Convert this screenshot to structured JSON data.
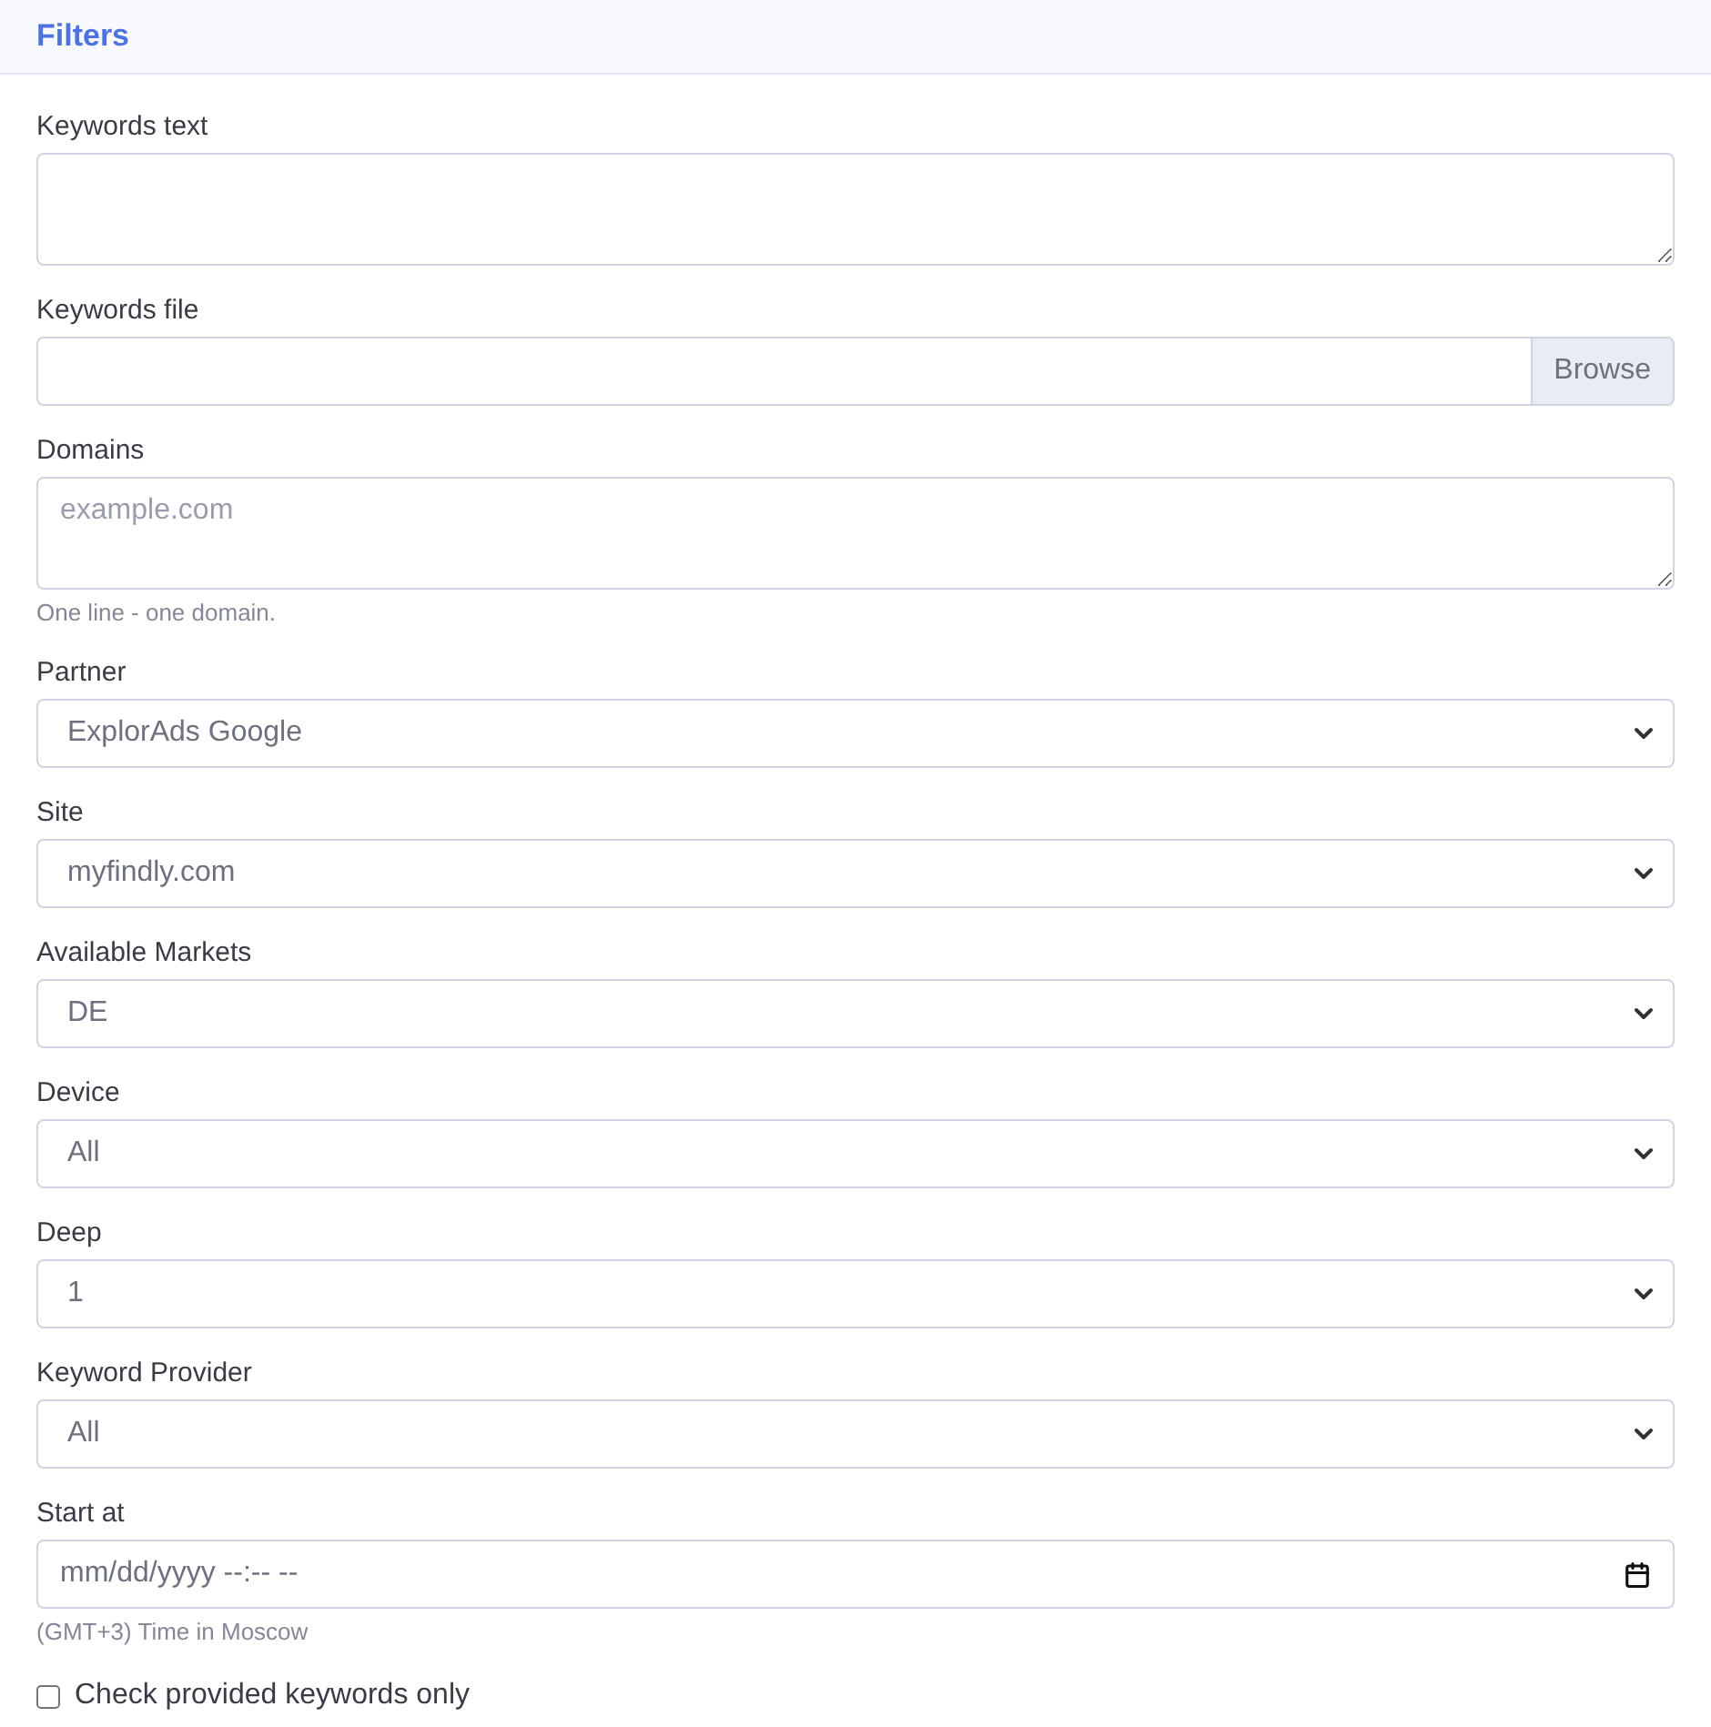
{
  "header": {
    "title": "Filters"
  },
  "fields": [
    {
      "kind": "textarea",
      "label": "Keywords text"
    },
    {
      "kind": "file",
      "label": "Keywords file",
      "button": "Browse"
    },
    {
      "kind": "textarea",
      "label": "Domains",
      "placeholder": "example.com",
      "help": "One line - one domain."
    },
    {
      "kind": "select",
      "label": "Partner",
      "value": "ExplorAds Google"
    },
    {
      "kind": "select",
      "label": "Site",
      "value": "myfindly.com"
    },
    {
      "kind": "select",
      "label": "Available Markets",
      "value": "DE"
    },
    {
      "kind": "select",
      "label": "Device",
      "value": "All"
    },
    {
      "kind": "select",
      "label": "Deep",
      "value": "1"
    },
    {
      "kind": "select",
      "label": "Keyword Provider",
      "value": "All"
    },
    {
      "kind": "datetime",
      "label": "Start at",
      "placeholder": "mm/dd/yyyy --:-- --",
      "help": "(GMT+3) Time in Moscow"
    }
  ],
  "checkbox": {
    "label": "Check provided keywords only",
    "checked": false
  }
}
